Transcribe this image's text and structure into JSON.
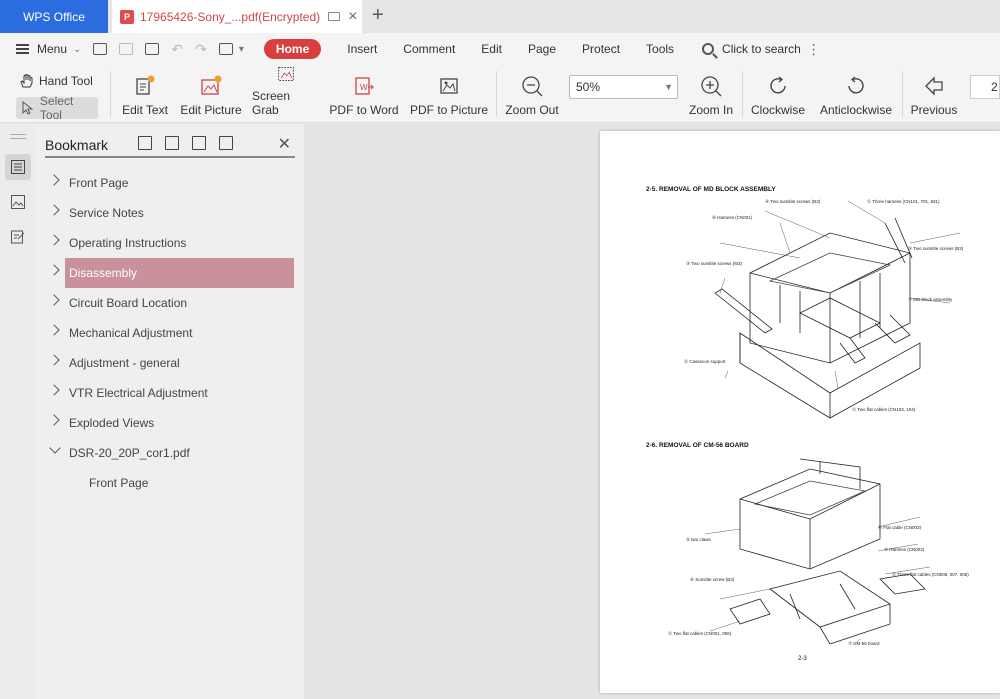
{
  "tabs": {
    "app_label": "WPS Office",
    "doc_title": "17965426-Sony_...pdf(Encrypted)",
    "new_tab": "+"
  },
  "menu": {
    "menu_label": "Menu",
    "items": [
      "Insert",
      "Comment",
      "Edit",
      "Page",
      "Protect",
      "Tools"
    ],
    "home": "Home",
    "search": "Click to search"
  },
  "ribbon": {
    "hand_tool": "Hand Tool",
    "select_tool": "Select Tool",
    "edit_text": "Edit Text",
    "edit_picture": "Edit Picture",
    "screen_grab": "Screen Grab",
    "pdf_to_word": "PDF to Word",
    "pdf_to_picture": "PDF to Picture",
    "zoom_out": "Zoom Out",
    "zoom_value": "50%",
    "zoom_in": "Zoom In",
    "clockwise": "Clockwise",
    "anticlockwise": "Anticlockwise",
    "previous": "Previous",
    "page_number": "2"
  },
  "bookmark": {
    "title": "Bookmark",
    "items": [
      {
        "label": "Front Page"
      },
      {
        "label": "Service Notes"
      },
      {
        "label": "Operating Instructions"
      },
      {
        "label": "Disassembly"
      },
      {
        "label": "Circuit Board Location"
      },
      {
        "label": "Mechanical Adjustment"
      },
      {
        "label": "Adjustment - general"
      },
      {
        "label": "VTR Electrical Adjustment"
      },
      {
        "label": "Exploded Views"
      },
      {
        "label": "DSR-20_20P_cor1.pdf"
      },
      {
        "label": "Front Page"
      }
    ]
  },
  "pdf": {
    "section1_title": "2-5.  REMOVAL  OF  MD  BLOCK  ASSEMBLY",
    "section2_title": "2-6.  REMOVAL  OF  CM-56  BOARD",
    "page_footer": "2-3",
    "callouts1": [
      "④ Two sumitite screws (B3)",
      "⑥ Harness (CN001)",
      "① Three harness (CN101, 701, 831)",
      "③ Two sumitite screws (M3)",
      "⑤ Two sumitite screws (B3)",
      "⑦ MD block assembly",
      "② Cassecon support",
      "① Two flat cables (CN103, 104)"
    ],
    "callouts2": [
      "④ Flat cable (CN003)",
      "⑤ two claws",
      "③ Harness (CN002)",
      "② Three flat cables (CN006, 007, 008)",
      "⑥ Sumitite screw (B3)",
      "① Two flat cables (CN001, 006)",
      "⑦ CM-56 board"
    ]
  }
}
